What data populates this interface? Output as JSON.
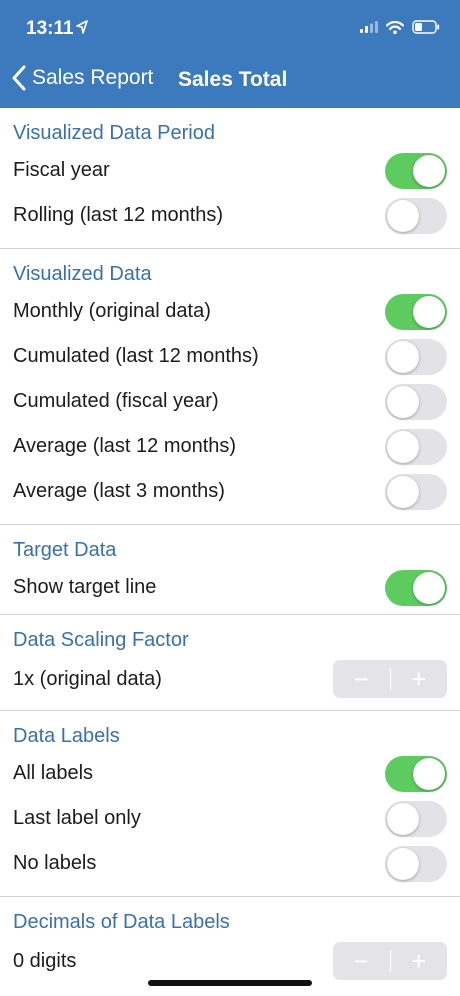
{
  "status": {
    "time": "13:11"
  },
  "nav": {
    "back_label": "Sales Report",
    "title": "Sales Total"
  },
  "colors": {
    "accent": "#3d79bd",
    "toggle_on": "#5ecb61",
    "toggle_off": "#e3e3e7"
  },
  "sections": {
    "period": {
      "title": "Visualized Data Period",
      "rows": [
        {
          "label": "Fiscal year",
          "on": true
        },
        {
          "label": "Rolling (last 12 months)",
          "on": false
        }
      ]
    },
    "data": {
      "title": "Visualized Data",
      "rows": [
        {
          "label": "Monthly (original data)",
          "on": true
        },
        {
          "label": "Cumulated (last 12 months)",
          "on": false
        },
        {
          "label": "Cumulated (fiscal year)",
          "on": false
        },
        {
          "label": "Average (last 12 months)",
          "on": false
        },
        {
          "label": "Average (last 3 months)",
          "on": false
        }
      ]
    },
    "target": {
      "title": "Target Data",
      "rows": [
        {
          "label": "Show target line",
          "on": true
        }
      ]
    },
    "scaling": {
      "title": "Data Scaling Factor",
      "value": "1x (original data)",
      "minus": "−",
      "plus": "+"
    },
    "labels": {
      "title": "Data Labels",
      "rows": [
        {
          "label": "All labels",
          "on": true
        },
        {
          "label": "Last label only",
          "on": false
        },
        {
          "label": "No labels",
          "on": false
        }
      ]
    },
    "decimals": {
      "title": "Decimals of Data Labels",
      "value": "0 digits",
      "minus": "−",
      "plus": "+"
    }
  }
}
